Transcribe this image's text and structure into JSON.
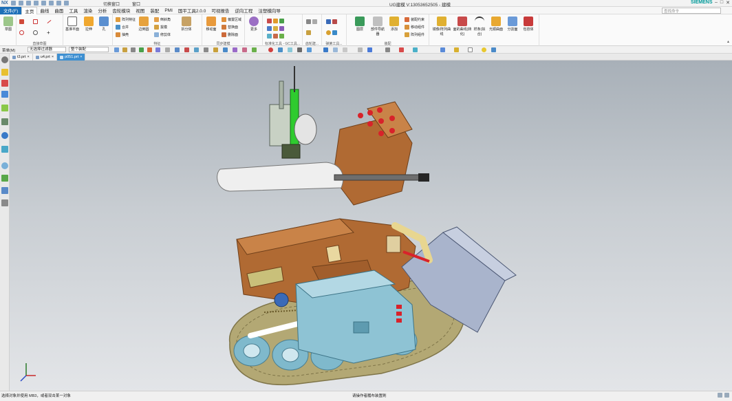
{
  "titlebar": {
    "app_short": "NX",
    "switch_window": "切换窗口",
    "window_menu": "窗口",
    "title": "UG建模   V:13053652505 - 建模",
    "brand": "SIEMENS"
  },
  "menubar": {
    "file": "文件(F)",
    "items": [
      "主页",
      "曲线",
      "曲面",
      "工具",
      "渲染",
      "分析",
      "齿轮模块",
      "视图",
      "装配",
      "PMI",
      "国平工具2.0.0",
      "可视报告",
      "逆向工程",
      "注塑模向导"
    ],
    "search_placeholder": "查找命令"
  },
  "ribbon": {
    "groups": [
      {
        "label": "直接草图",
        "buttons": [
          "草图"
        ]
      },
      {
        "label": "",
        "buttons": [
          "基准平面",
          "拉伸",
          "孔"
        ]
      },
      {
        "label": "特征",
        "buttons": [
          "阵列特征",
          "合并",
          "抽壳",
          "边倒圆",
          "倒斜角",
          "拔模",
          "修剪体",
          "拆分体"
        ]
      },
      {
        "label": "同步建模",
        "buttons": [
          "移动面",
          "偏置区域",
          "替换面",
          "删除面"
        ]
      },
      {
        "label": "",
        "buttons": [
          "更多"
        ]
      },
      {
        "label": "标准化工具 - GC工具...",
        "buttons": []
      },
      {
        "label": "齿轮建...",
        "buttons": []
      },
      {
        "label": "弹簧工具...",
        "buttons": []
      },
      {
        "label": "装配",
        "buttons": [
          "图层",
          "部件导航器",
          "添加",
          "装配约束",
          "移动组件",
          "阵列组件"
        ]
      },
      {
        "label": "",
        "buttons": [
          "镜像/阵列曲线",
          "面的曲线(转化)",
          "样条(拟合)",
          "光顺曲面",
          "分割面",
          "包容体"
        ]
      }
    ]
  },
  "toolbar": {
    "menu": "菜单(M)",
    "filter": "无选择过滤器",
    "scope": "整个装配"
  },
  "tabs": [
    {
      "label": "t3.prt",
      "active": false
    },
    {
      "label": "u4.prt",
      "active": false
    },
    {
      "label": "p051.prt",
      "active": true
    }
  ],
  "statusbar": {
    "left": "选择对象并使用 MB3，或者双击某一对象",
    "center": "请操作者履布装置刷"
  },
  "colors": {
    "accent": "#1d6fb8",
    "tab_active": "#3d8fd1",
    "body_copper": "#b06a33",
    "track_khaki": "#b3a874",
    "module_blue": "#8ec3d4",
    "box_grey": "#a9b4cc"
  }
}
